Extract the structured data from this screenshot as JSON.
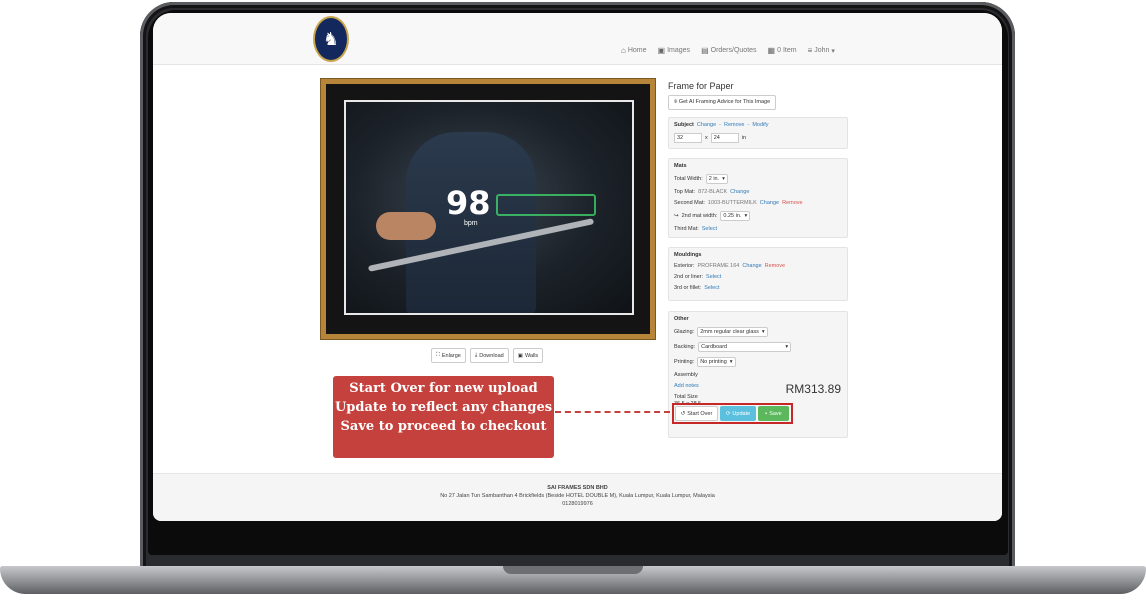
{
  "nav": {
    "items": [
      {
        "label": "Home",
        "icon": "home-icon"
      },
      {
        "label": "Images",
        "icon": "image-icon"
      },
      {
        "label": "Orders/Quotes",
        "icon": "document-icon"
      },
      {
        "label": "0 Item",
        "icon": "cart-icon"
      },
      {
        "label": "John",
        "icon": "menu-icon"
      }
    ]
  },
  "image_actions": {
    "enlarge": "Enlarge",
    "download": "Download",
    "walls": "Walls"
  },
  "photo_overlay": {
    "value": "98",
    "unit": "bpm"
  },
  "panel": {
    "title": "Frame for Paper",
    "advice_button": "Get AI Framing Advice for This Image",
    "subject": {
      "heading": "Subject",
      "links": [
        "Change",
        "Remove",
        "Modify"
      ],
      "width": "32",
      "times": "x",
      "height": "24",
      "unit": "in"
    },
    "mats": {
      "heading": "Mats",
      "total_width_label": "Total Width:",
      "total_width_value": "2 in.",
      "top_mat_label": "Top Mat:",
      "top_mat_value": "872-BLACK",
      "top_mat_change": "Change",
      "second_mat_label": "Second Mat:",
      "second_mat_value": "1003-BUTTERMILK",
      "second_mat_change": "Change",
      "second_mat_remove": "Remove",
      "second_width_label": "2nd mat width:",
      "second_width_value": "0.25 in.",
      "third_mat_label": "Third Mat:",
      "third_mat_select": "Select"
    },
    "mouldings": {
      "heading": "Mouldings",
      "exterior_label": "Exterior:",
      "exterior_value": "PROFRAME 164",
      "exterior_change": "Change",
      "exterior_remove": "Remove",
      "liner_label": "2nd or liner:",
      "liner_select": "Select",
      "fillet_label": "3rd or fillet:",
      "fillet_select": "Select"
    },
    "other": {
      "heading": "Other",
      "glazing_label": "Glazing:",
      "glazing_value": "2mm regular clear glass",
      "backing_label": "Backing:",
      "backing_value": "Cardboard",
      "printing_label": "Printing:",
      "printing_value": "No printing",
      "assembly_label": "Assembly",
      "add_notes": "Add notes",
      "total_size_label": "Total Size",
      "total_size_value": "36.5 x 28.5",
      "price": "RM313.89",
      "start_over": "Start Over",
      "update": "Update",
      "save": "Save"
    }
  },
  "callout": {
    "line1": "Start Over for new upload",
    "line2": "Update to reflect any changes",
    "line3": "Save to proceed to checkout"
  },
  "footer": {
    "company": "SAI FRAMES SDN BHD",
    "address": "No 27 Jalan Tun Sambanthan 4 Brickfields (Beside HOTEL DOUBLE M), Kuala Lumpur, Kuala Lumpur, Malaysia",
    "phone": "0128019976"
  },
  "colors": {
    "link": "#337ab7",
    "danger": "#d9534f",
    "info": "#5bc0de",
    "success": "#5cb85c",
    "frame_gold": "#b7853a",
    "callout": "#c4413d"
  }
}
